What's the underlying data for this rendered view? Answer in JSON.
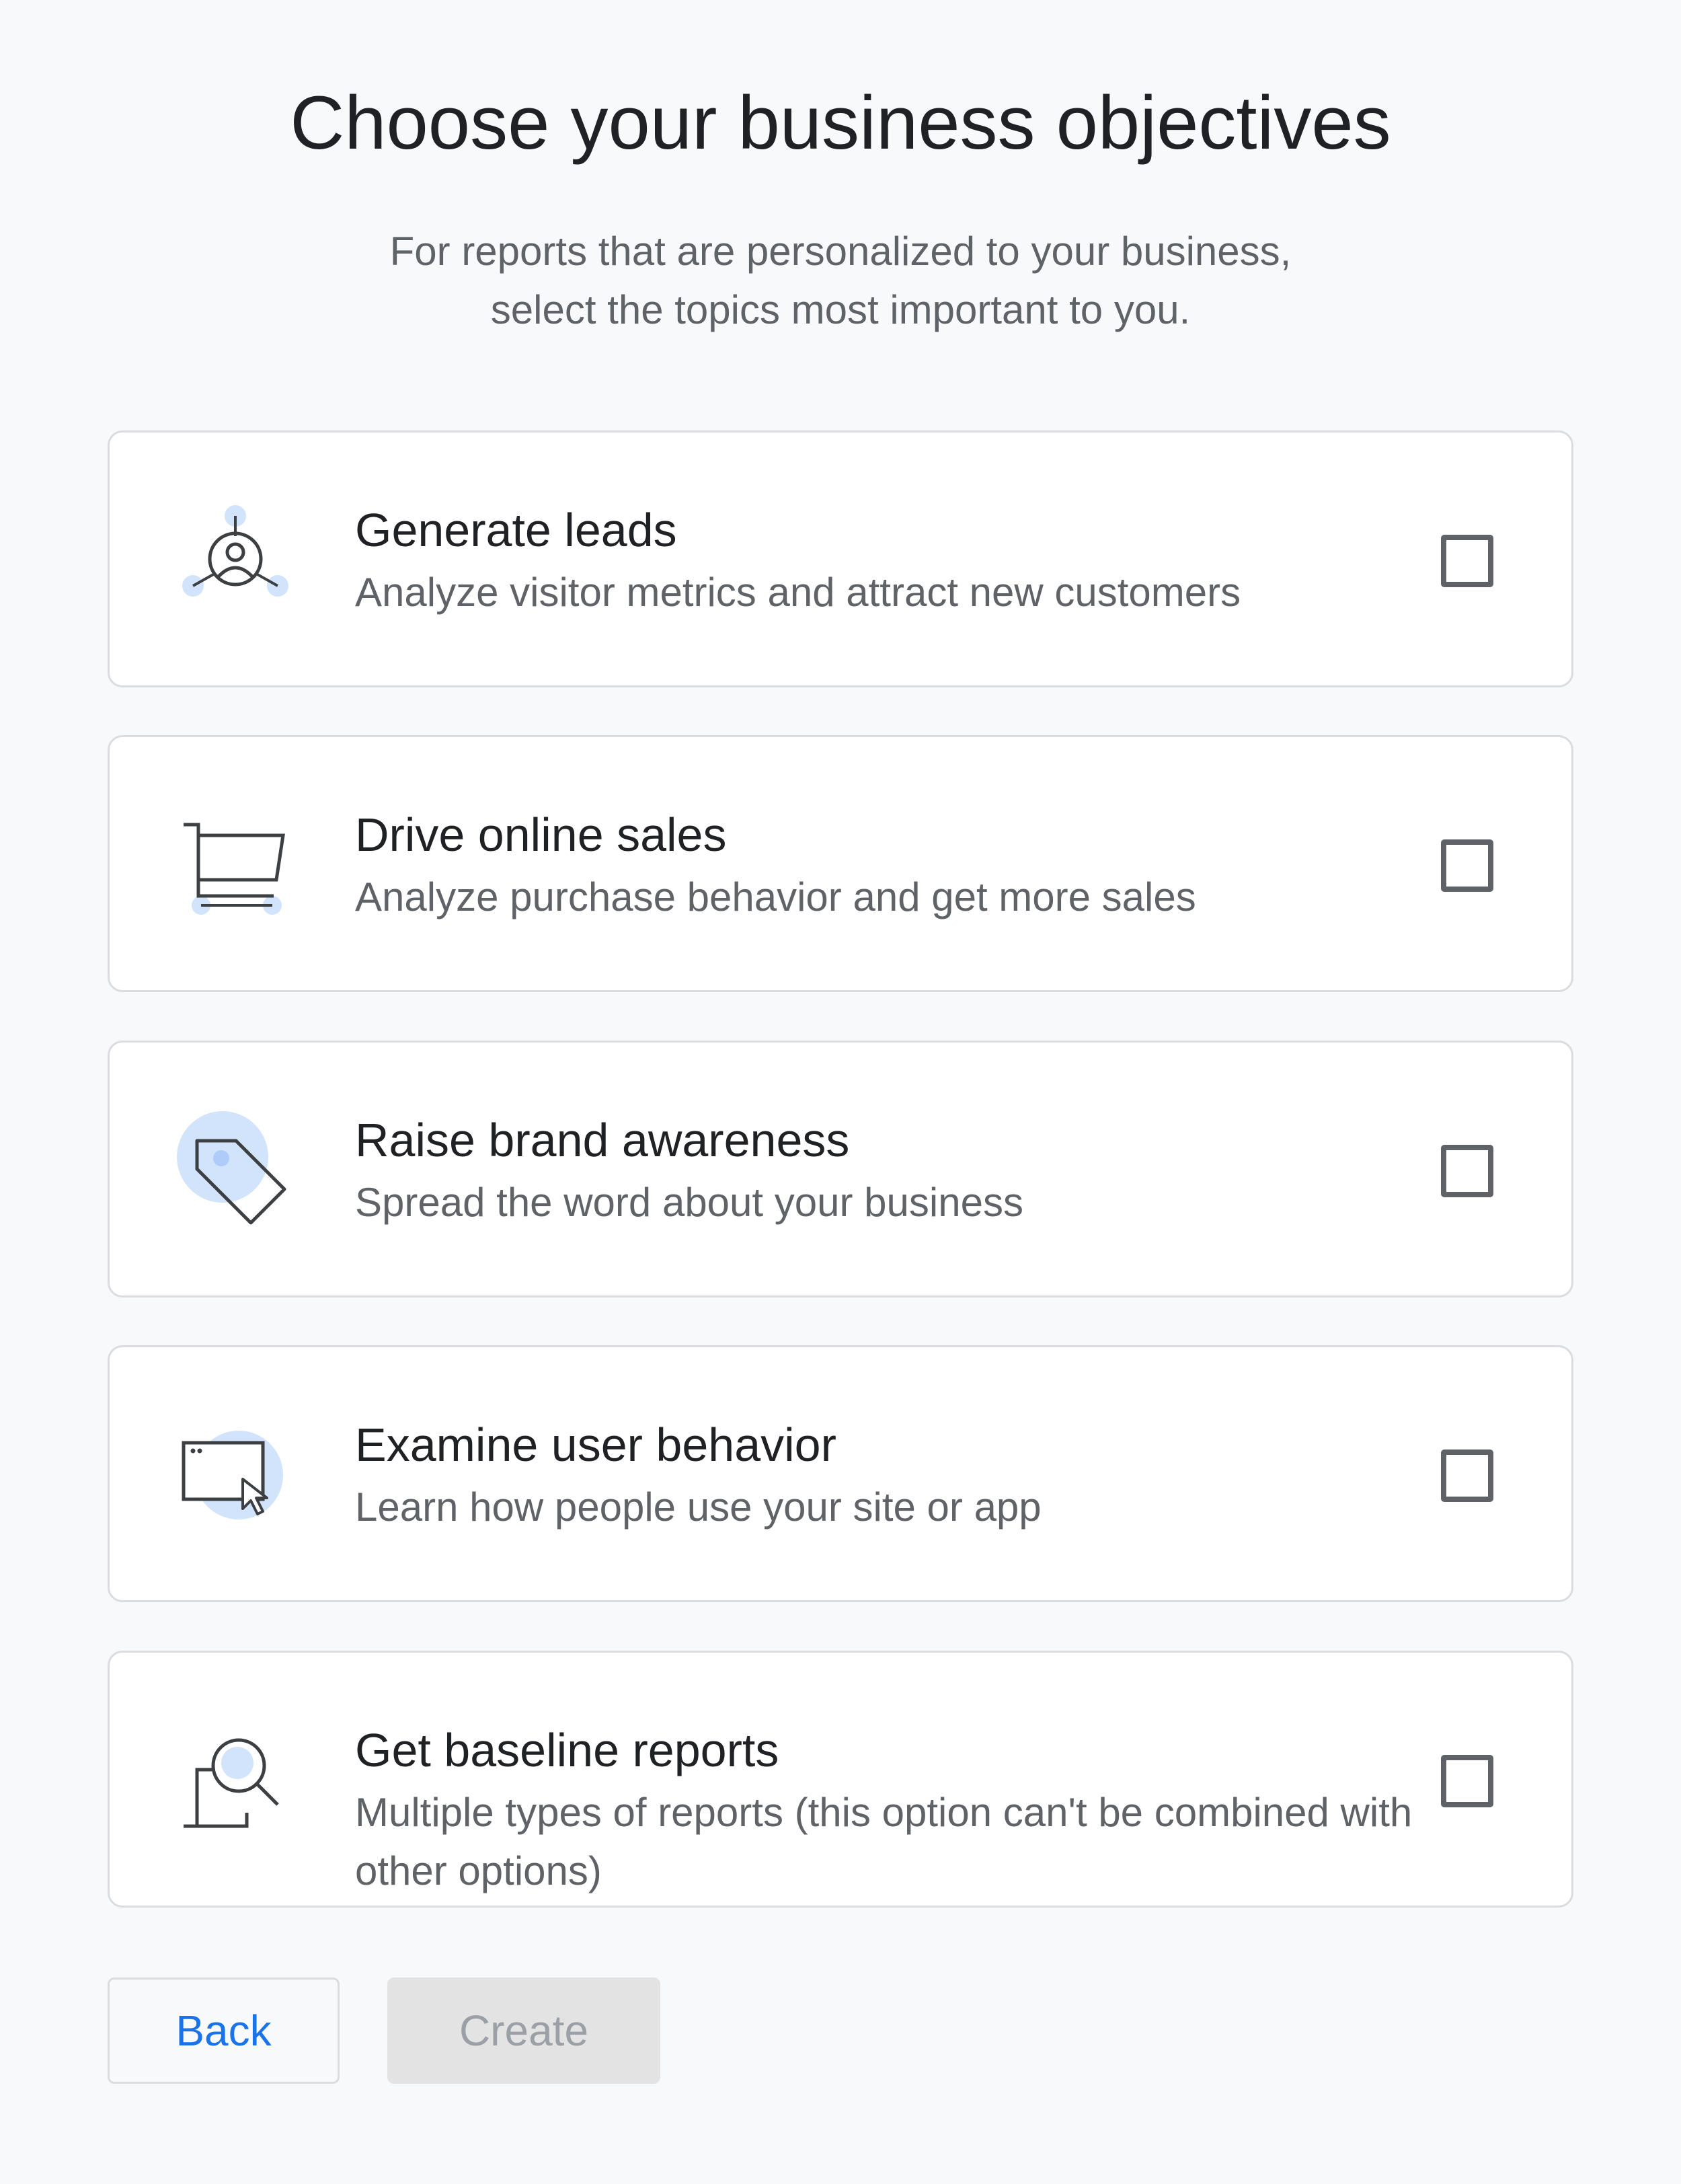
{
  "header": {
    "title": "Choose your business objectives",
    "subtitle_line1": "For reports that are personalized to your business,",
    "subtitle_line2": "select the topics most important to you."
  },
  "objectives": [
    {
      "label": "Generate leads",
      "description": "Analyze visitor metrics and attract new customers",
      "icon": "leads-network-icon",
      "checked": false
    },
    {
      "label": "Drive online sales",
      "description": "Analyze purchase behavior and get more sales",
      "icon": "shopping-cart-icon",
      "checked": false
    },
    {
      "label": "Raise brand awareness",
      "description": "Spread the word about your business",
      "icon": "price-tag-icon",
      "checked": false
    },
    {
      "label": "Examine user behavior",
      "description": "Learn how people use your site or app",
      "icon": "browser-cursor-icon",
      "checked": false
    },
    {
      "label": "Get baseline reports",
      "description": "Multiple types of reports (this option can't be combined with other options)",
      "icon": "magnifier-report-icon",
      "checked": false
    }
  ],
  "actions": {
    "back_label": "Back",
    "create_label": "Create",
    "create_enabled": false
  },
  "colors": {
    "accent": "#1a73e8",
    "icon_highlight": "#d2e3fc",
    "icon_stroke": "#3c4043",
    "card_border": "#dadce0",
    "disabled_bg": "#e3e3e3",
    "disabled_text": "#9aa0a6"
  }
}
